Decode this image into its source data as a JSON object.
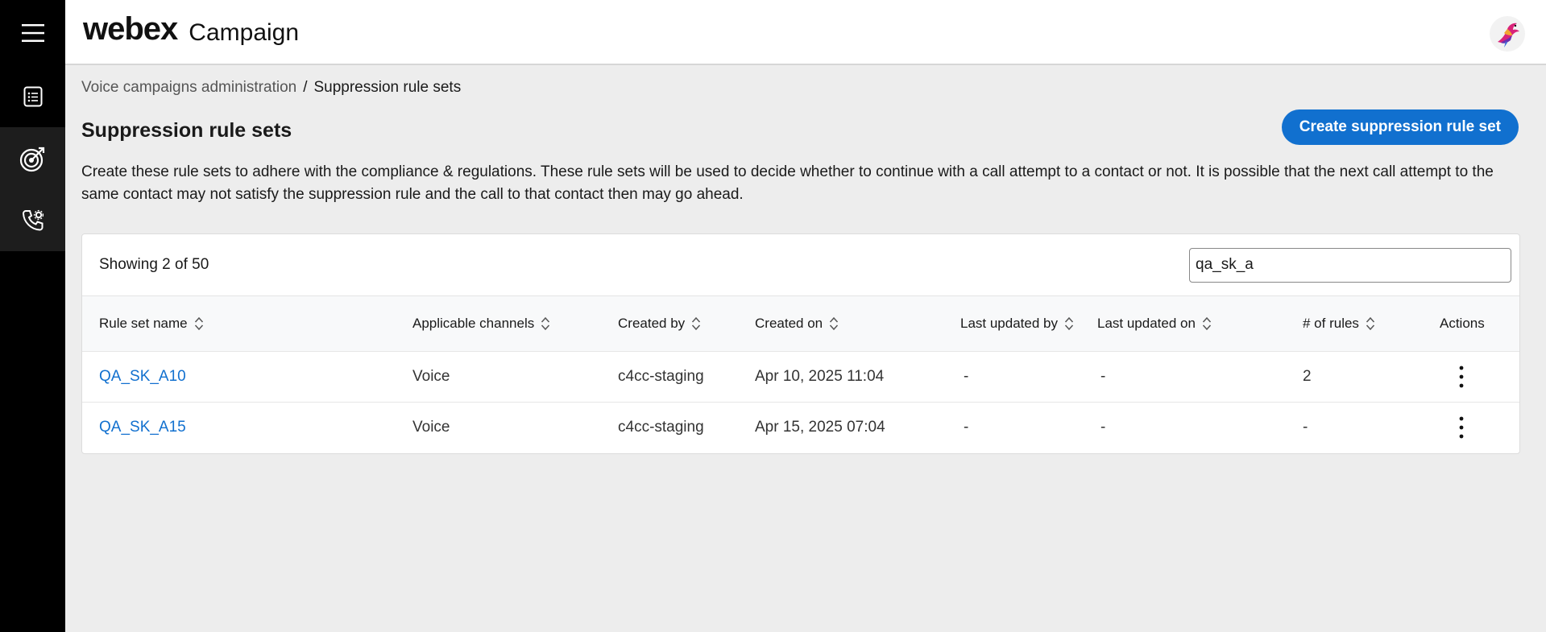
{
  "header": {
    "logo": "webex",
    "product": "Campaign"
  },
  "rail": {
    "items": [
      {
        "icon": "hamburger-menu-icon"
      },
      {
        "icon": "list-document-icon"
      },
      {
        "icon": "target-icon"
      },
      {
        "icon": "phone-settings-icon"
      }
    ]
  },
  "breadcrumb": {
    "parent": "Voice campaigns administration",
    "separator": "/",
    "current": "Suppression rule sets"
  },
  "page": {
    "title": "Suppression rule sets",
    "create_button": "Create suppression rule set",
    "description": "Create these rule sets to adhere with the compliance & regulations. These rule sets will be used to decide whether to continue with a call attempt to a contact or not. It is possible that the next call attempt to the same contact may not satisfy the suppression rule and the call to that contact then may go ahead."
  },
  "table": {
    "showing": "Showing 2 of 50",
    "search_value": "qa_sk_a",
    "columns": {
      "name": "Rule set name",
      "channels": "Applicable channels",
      "created_by": "Created by",
      "created_on": "Created on",
      "updated_by": "Last updated by",
      "updated_on": "Last updated on",
      "rules": "# of rules",
      "actions": "Actions"
    },
    "rows": [
      {
        "name": "QA_SK_A10",
        "channels": "Voice",
        "created_by": "c4cc-staging",
        "created_on": "Apr 10, 2025 11:04",
        "updated_by": "-",
        "updated_on": "-",
        "rules": "2"
      },
      {
        "name": "QA_SK_A15",
        "channels": "Voice",
        "created_by": "c4cc-staging",
        "created_on": "Apr 15, 2025 07:04",
        "updated_by": "-",
        "updated_on": "-",
        "rules": "-"
      }
    ]
  },
  "colors": {
    "primary": "#1170cf",
    "rail": "#000000",
    "background": "#ededed"
  }
}
